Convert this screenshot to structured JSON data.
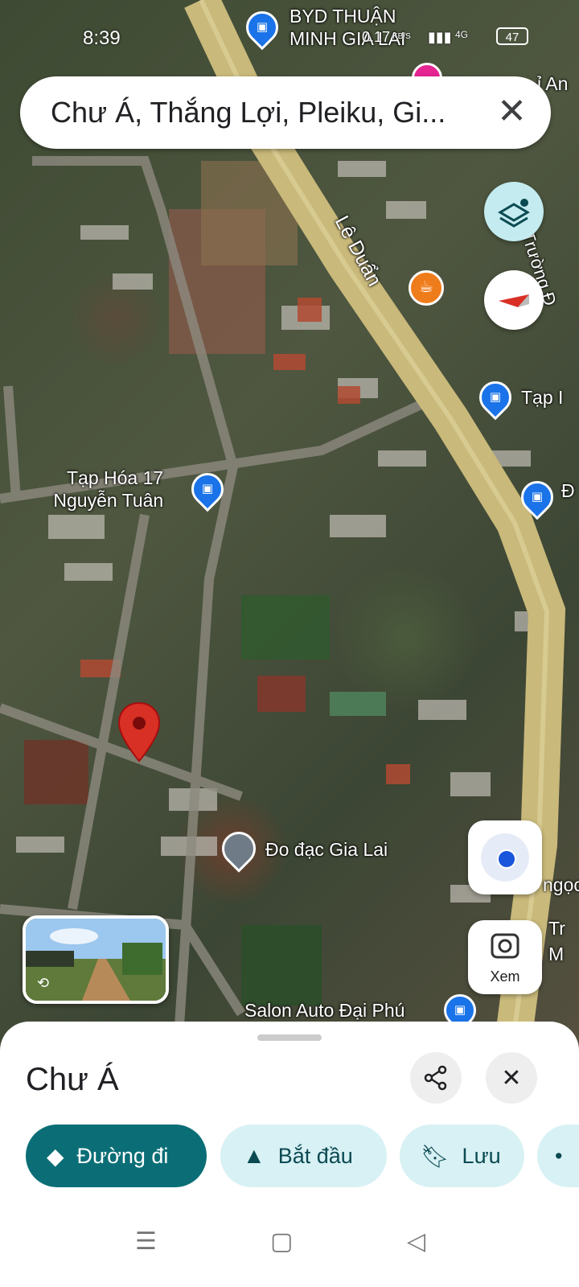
{
  "status_bar": {
    "time": "8:39",
    "network": "0.17",
    "network_unit": "KB/S",
    "cellular": "4G",
    "battery": "47"
  },
  "search": {
    "query": "Chư Á, Thắng Lợi, Pleiku, Gi..."
  },
  "map": {
    "road_label": "Lê Duẩn",
    "street_label_right": "Trường Đ",
    "pois": [
      {
        "label": "BYD THUẬN",
        "label2": "MINH GIA LAI"
      },
      {
        "label": "Tạp Hóa 17",
        "label2": "Nguyễn Tuân"
      },
      {
        "label": "Tạp I"
      },
      {
        "label": "Đo đạc Gia Lai"
      },
      {
        "label": "Salon Auto Đại Phú"
      }
    ],
    "edge_fragments": [
      "ỉ An",
      "ngọc",
      "Tr",
      "M",
      "Đ"
    ]
  },
  "streetview": {
    "label": "street view preview"
  },
  "controls": {
    "lens_label": "Xem"
  },
  "sheet": {
    "title": "Chư Á",
    "actions": [
      {
        "label": "Đường đi"
      },
      {
        "label": "Bắt đầu"
      },
      {
        "label": "Lưu"
      }
    ]
  },
  "colors": {
    "primary_dark": "#0b6e76",
    "chip_light": "#d8f1f4",
    "poi_blue": "#1a73e8",
    "pin_red": "#d93025",
    "road": "#c9b97a"
  }
}
